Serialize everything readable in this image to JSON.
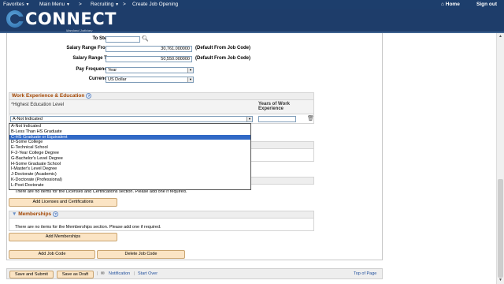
{
  "topnav": {
    "favorites": "Favorites",
    "main_menu": "Main Menu",
    "crumb_recruiting": "Recruiting",
    "crumb_page": "Create Job Opening",
    "home": "Home",
    "sign_out": "Sign out"
  },
  "logo": {
    "text": "CONNECT",
    "subtitle": "Maryland Judiciary"
  },
  "form": {
    "to_step_label": "To Step",
    "salary_from_label": "Salary Range From",
    "salary_from_value": "30,761.000000",
    "salary_from_note": "(Default From Job Code)",
    "salary_to_label": "Salary Range To",
    "salary_to_value": "50,550.000000",
    "salary_to_note": "(Default From Job Code)",
    "pay_frequency_label": "Pay Frequency",
    "pay_frequency_value": "Year",
    "currency_label": "Currency",
    "currency_value": "US Dollar"
  },
  "work_experience": {
    "title": "Work Experience & Education",
    "col_education": "*Highest Education Level",
    "col_years": "Years of Work Experience",
    "selected": "A-Not Indicated",
    "options": [
      "A-Not Indicated",
      "B-Less Than HS Graduate",
      "C-HS Graduate or Equivalent",
      "D-Some College",
      "E-Technical School",
      "F-2-Year College Degree",
      "G-Bachelor's Level Degree",
      "H-Some Graduate School",
      "I-Master's Level Degree",
      "J-Doctorate (Academic)",
      "K-Doctorate (Professional)",
      "L-Post-Doctorate"
    ],
    "highlighted_index": 2
  },
  "licenses": {
    "empty_msg": "There are no items for the Licenses and Certifications section.  Please add one if required.",
    "add_button": "Add Licenses and Certifications"
  },
  "memberships": {
    "title": "Memberships",
    "empty_msg": "There are no items for the Memberships section.  Please add one if required.",
    "add_button": "Add Memberships"
  },
  "job_code": {
    "add_button": "Add Job Code",
    "delete_button": "Delete Job Code"
  },
  "footer": {
    "save_submit": "Save and Submit",
    "save_draft": "Save as Draft",
    "notification": "Notification",
    "start_over": "Start Over",
    "top_of_page": "Top of Page"
  }
}
